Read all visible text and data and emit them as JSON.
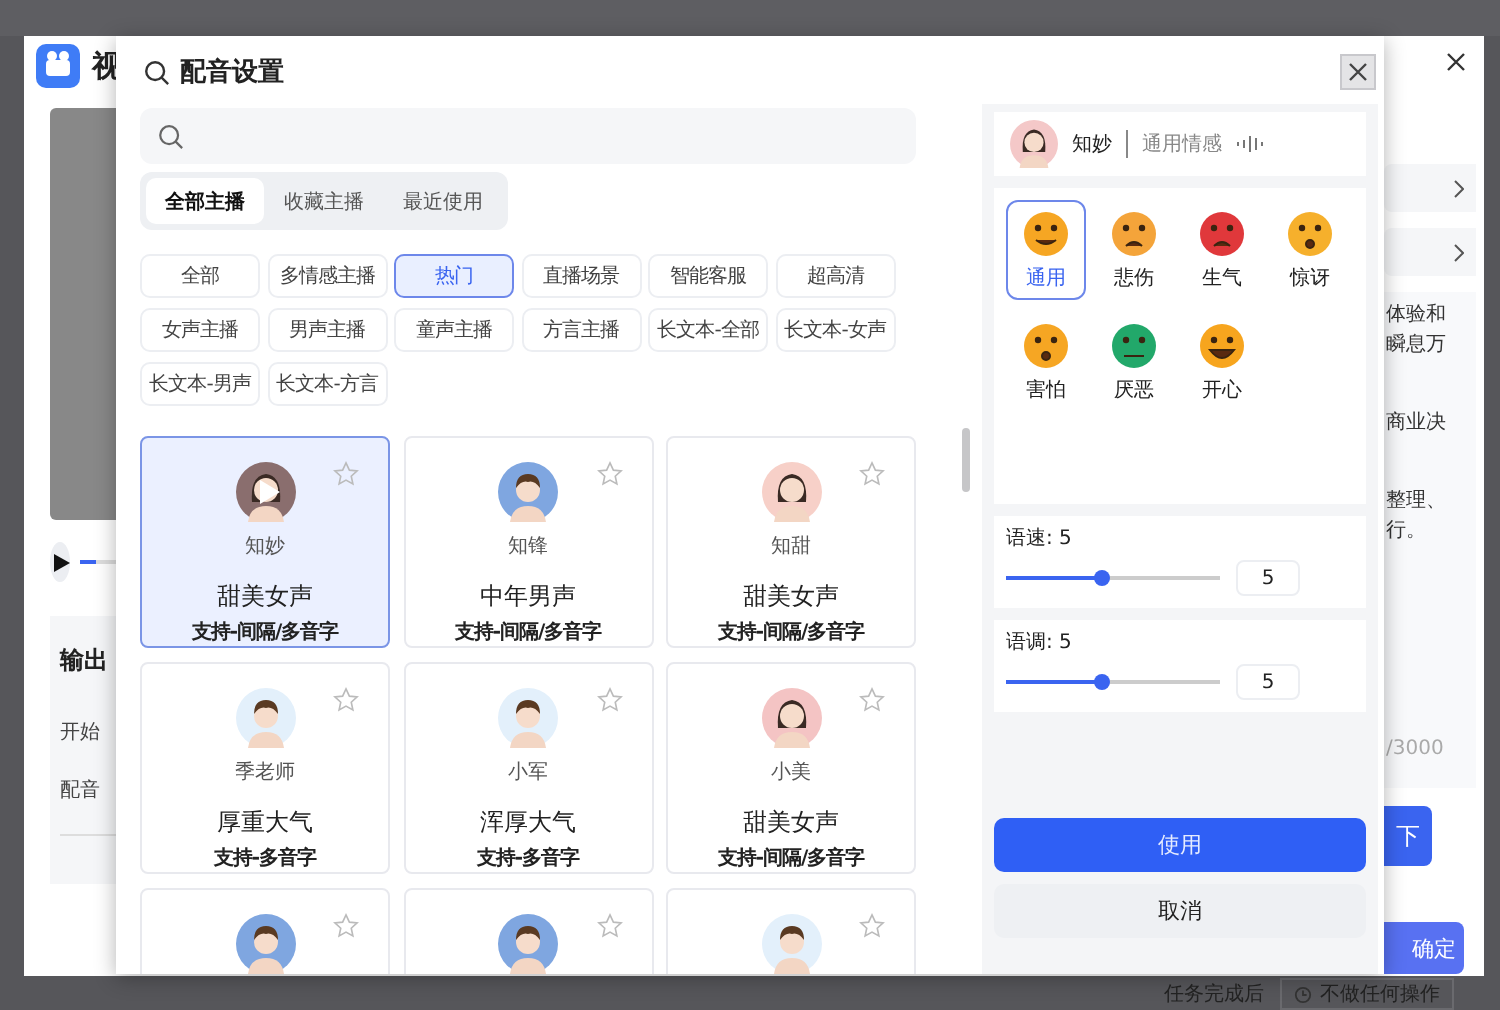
{
  "app": {
    "title": "视",
    "left": {
      "playback": {
        "level": 0.04
      },
      "section_title": "输出",
      "labels": [
        "开始",
        "配音"
      ]
    },
    "right": {
      "text_lines": [
        "体验和",
        "瞬息万",
        "商业决",
        "整理、",
        "行。"
      ],
      "counter": "/3000",
      "button": "下",
      "confirm": "确定"
    },
    "footer": {
      "label": "任务完成后",
      "select": "不做任何操作"
    }
  },
  "dialog": {
    "title": "配音设置",
    "tabs": [
      {
        "label": "全部主播",
        "selected": true
      },
      {
        "label": "收藏主播",
        "selected": false
      },
      {
        "label": "最近使用",
        "selected": false
      }
    ],
    "filters": [
      {
        "label": "全部",
        "selected": false
      },
      {
        "label": "多情感主播",
        "selected": false
      },
      {
        "label": "热门",
        "selected": true
      },
      {
        "label": "直播场景",
        "selected": false
      },
      {
        "label": "智能客服",
        "selected": false
      },
      {
        "label": "超高清",
        "selected": false
      },
      {
        "label": "女声主播",
        "selected": false
      },
      {
        "label": "男声主播",
        "selected": false
      },
      {
        "label": "童声主播",
        "selected": false
      },
      {
        "label": "方言主播",
        "selected": false
      },
      {
        "label": "长文本-全部",
        "selected": false
      },
      {
        "label": "长文本-女声",
        "selected": false
      },
      {
        "label": "长文本-男声",
        "selected": false
      },
      {
        "label": "长文本-方言",
        "selected": false
      }
    ],
    "voices": [
      {
        "name": "知妙",
        "title": "甜美女声",
        "tags": "支持-间隔/多音字",
        "kind": "female",
        "color": "#8a6e6e",
        "selected": true,
        "playing": true
      },
      {
        "name": "知锋",
        "title": "中年男声",
        "tags": "支持-间隔/多音字",
        "kind": "male",
        "color": "#7fa6e0",
        "selected": false,
        "playing": false
      },
      {
        "name": "知甜",
        "title": "甜美女声",
        "tags": "支持-间隔/多音字",
        "kind": "female",
        "color": "#f7d0c8",
        "selected": false,
        "playing": false
      },
      {
        "name": "季老师",
        "title": "厚重大气",
        "tags": "支持-多音字",
        "kind": "male",
        "color": "#e3f0fb",
        "selected": false,
        "playing": false
      },
      {
        "name": "小军",
        "title": "浑厚大气",
        "tags": "支持-多音字",
        "kind": "male",
        "color": "#e3f0fb",
        "selected": false,
        "playing": false
      },
      {
        "name": "小美",
        "title": "甜美女声",
        "tags": "支持-间隔/多音字",
        "kind": "female",
        "color": "#f4c4c4",
        "selected": false,
        "playing": false
      },
      {
        "kind": "male",
        "color": "#7fa6e0",
        "selected": false,
        "playing": false
      },
      {
        "kind": "male",
        "color": "#7fa6e0",
        "selected": false,
        "playing": false
      },
      {
        "kind": "male",
        "color": "#e3f0fb",
        "selected": false,
        "playing": false
      }
    ],
    "preview": {
      "name": "知妙",
      "emotion": "通用情感"
    },
    "emotions": [
      {
        "label": "通用",
        "kind": "neutral",
        "selected": true
      },
      {
        "label": "悲伤",
        "kind": "sad",
        "selected": false
      },
      {
        "label": "生气",
        "kind": "angry",
        "selected": false
      },
      {
        "label": "惊讶",
        "kind": "surprised",
        "selected": false
      },
      {
        "label": "害怕",
        "kind": "scared",
        "selected": false
      },
      {
        "label": "厌恶",
        "kind": "disgusted",
        "selected": false
      },
      {
        "label": "开心",
        "kind": "happy",
        "selected": false
      }
    ],
    "sliders": [
      {
        "label": "语速:",
        "reading": "5",
        "level": 0.45,
        "value": "5"
      },
      {
        "label": "语调:",
        "reading": "5",
        "level": 0.45,
        "value": "5"
      }
    ],
    "buttons": [
      {
        "label": "使用",
        "kind": "primary"
      },
      {
        "label": "取消",
        "kind": "secondary"
      }
    ]
  }
}
